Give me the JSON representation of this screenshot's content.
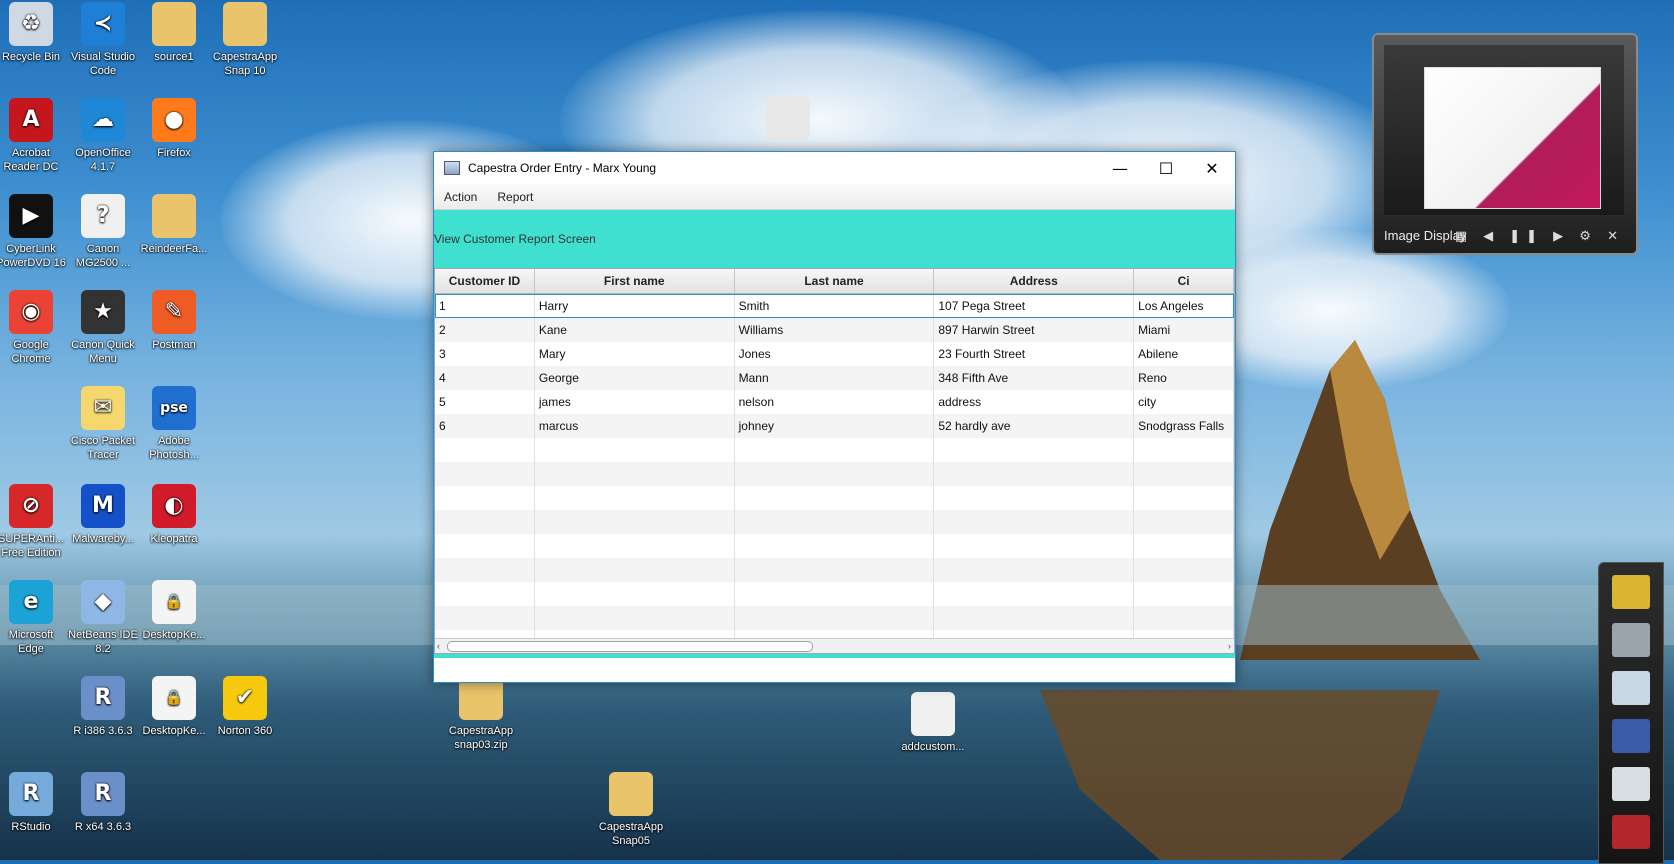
{
  "desktop": {
    "icons": [
      {
        "label": "Recycle Bin",
        "icon": "recycle-bin-icon",
        "color": "#cfd8e3",
        "glyph": "♻"
      },
      {
        "label": "Visual Studio Code",
        "icon": "vscode-icon",
        "color": "#1f7fd6",
        "glyph": "≺"
      },
      {
        "label": "source1",
        "icon": "folder-icon",
        "color": "#e9c46a",
        "glyph": ""
      },
      {
        "label": "CapestraApp Snap 10",
        "icon": "zip-folder-icon",
        "color": "#e9c46a",
        "glyph": ""
      },
      {
        "label": "Acrobat Reader DC",
        "icon": "acrobat-icon",
        "color": "#c4161c",
        "glyph": "A"
      },
      {
        "label": "OpenOffice 4.1.7",
        "icon": "openoffice-icon",
        "color": "#1e88d6",
        "glyph": "☁"
      },
      {
        "label": "Firefox",
        "icon": "firefox-icon",
        "color": "#ff7a1a",
        "glyph": "●"
      },
      {
        "label": "CyberLink PowerDVD 16",
        "icon": "powerdvd-icon",
        "color": "#111111",
        "glyph": "▶"
      },
      {
        "label": "Canon MG2500 ...",
        "icon": "canon-help-icon",
        "color": "#f0f0f0",
        "glyph": "?"
      },
      {
        "label": "ReindeerFa...",
        "icon": "folder-icon",
        "color": "#e9c46a",
        "glyph": ""
      },
      {
        "label": "Google Chrome",
        "icon": "chrome-icon",
        "color": "#ea4335",
        "glyph": "◉"
      },
      {
        "label": "Canon Quick Menu",
        "icon": "canon-quick-menu-icon",
        "color": "#333333",
        "glyph": "★"
      },
      {
        "label": "Postman",
        "icon": "postman-icon",
        "color": "#ef5b25",
        "glyph": "✎"
      },
      {
        "label": "Cisco Packet Tracer",
        "icon": "packet-tracer-icon",
        "color": "#f5d76e",
        "glyph": "✉"
      },
      {
        "label": "Adobe Photosh...",
        "icon": "photoshop-elements-icon",
        "color": "#1f6fd1",
        "glyph": "pse"
      },
      {
        "label": "SUPERAnti... Free Edition",
        "icon": "superantispyware-icon",
        "color": "#d62828",
        "glyph": "⊘"
      },
      {
        "label": "Malwareby...",
        "icon": "malwarebytes-icon",
        "color": "#1450c8",
        "glyph": "M"
      },
      {
        "label": "Kleopatra",
        "icon": "kleopatra-icon",
        "color": "#d11a2a",
        "glyph": "◐"
      },
      {
        "label": "Microsoft Edge",
        "icon": "edge-icon",
        "color": "#1aa3d4",
        "glyph": "e"
      },
      {
        "label": "NetBeans IDE 8.2",
        "icon": "netbeans-icon",
        "color": "#8fb7e6",
        "glyph": "◆"
      },
      {
        "label": "DesktopKe...",
        "icon": "lock-file-icon",
        "color": "#f4f4f4",
        "glyph": "🔒"
      },
      {
        "label": "R i386 3.6.3",
        "icon": "r-icon",
        "color": "#6b8fc9",
        "glyph": "R"
      },
      {
        "label": "DesktopKe...",
        "icon": "lock-file-icon",
        "color": "#f4f4f4",
        "glyph": "🔒"
      },
      {
        "label": "Norton 360",
        "icon": "norton-icon",
        "color": "#f6c90e",
        "glyph": "✔"
      },
      {
        "label": "RStudio",
        "icon": "rstudio-icon",
        "color": "#75aadb",
        "glyph": "R"
      },
      {
        "label": "R x64 3.6.3",
        "icon": "r-icon",
        "color": "#6b8fc9",
        "glyph": "R"
      },
      {
        "label": "CapestraApp snap03.zip",
        "icon": "zip-folder-icon",
        "color": "#e9c46a",
        "glyph": ""
      },
      {
        "label": "addcustom...",
        "icon": "image-file-icon",
        "color": "#f0f0f0",
        "glyph": ""
      },
      {
        "label": "CapestraApp Snap05",
        "icon": "zip-folder-icon",
        "color": "#e9c46a",
        "glyph": ""
      },
      {
        "label": "",
        "icon": "folder-icon",
        "color": "#e8e8e8",
        "glyph": ""
      }
    ]
  },
  "window": {
    "title": "Capestra Order Entry - Marx Young",
    "minimize": "—",
    "maximize": "☐",
    "close": "✕",
    "menu": [
      "Action",
      "Report"
    ],
    "toolbar_link": "View Customer Report Screen",
    "table": {
      "columns": [
        "Customer ID",
        "First name",
        "Last name",
        "Address",
        "Ci"
      ],
      "rows": [
        [
          "1",
          "Harry",
          "Smith",
          "107 Pega Street",
          "Los Angeles"
        ],
        [
          "2",
          "Kane",
          "Williams",
          "897 Harwin Street",
          "Miami"
        ],
        [
          "3",
          "Mary",
          "Jones",
          "23 Fourth Street",
          "Abilene"
        ],
        [
          "4",
          "George",
          "Mann",
          "348 Fifth Ave",
          "Reno"
        ],
        [
          "5",
          "james",
          "nelson",
          "address",
          "city"
        ],
        [
          "6",
          "marcus",
          "johney",
          "52 hardly ave",
          "Snodgrass Falls"
        ]
      ],
      "empty_rows": 9
    }
  },
  "gadget": {
    "label": "Image Display",
    "controls": "▦ ◀ ❚❚ ▶ ⚙ ✕"
  },
  "colors": {
    "accent": "#40e0d0",
    "window_border": "#2b8ec8"
  }
}
